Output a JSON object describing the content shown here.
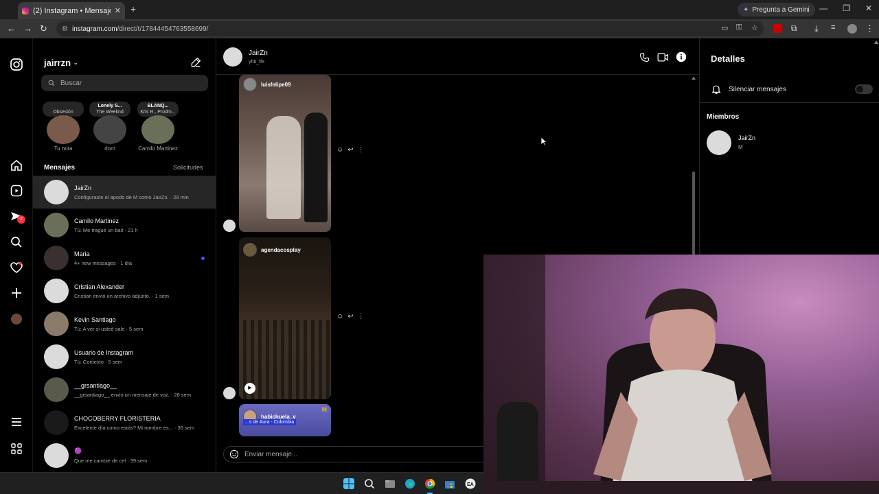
{
  "browser": {
    "tab_title": "(2) Instagram • Mensajes",
    "new_tab": "+",
    "gemini_label": "Pregunta a Gemini",
    "url_host": "instagram.com",
    "url_path": "/direct/t/17844454763558699/"
  },
  "inbox": {
    "username": "jairrzn",
    "search_placeholder": "Buscar",
    "notes": [
      {
        "bubble_title": "",
        "bubble_text": "Obsesión actual...",
        "name": "Tu nota",
        "color": "#7a5a4a"
      },
      {
        "bubble_title": "Lonely S...",
        "bubble_text": "The Weeknd",
        "name": "dom",
        "color": "#444444"
      },
      {
        "bubble_title": "BLANQ...",
        "bubble_text": "Kris R., Prodm...",
        "name": "Camilo Martinez",
        "color": "#6a6f5a"
      }
    ],
    "messages_header": "Mensajes",
    "requests_label": "Solicitudes",
    "conversations": [
      {
        "name": "JairZn",
        "preview": "Configuraste el apodo de M como JairZn. · 29 min",
        "color": "#dbdbdb",
        "unread": false
      },
      {
        "name": "Camilo Martinez",
        "preview": "Tú: Me tragué un bait · 21 h",
        "color": "#6a6f5a",
        "unread": false
      },
      {
        "name": "Maria",
        "preview": "4+ new messages · 1 día",
        "color": "#3a3030",
        "unread": true
      },
      {
        "name": "Cristian Alexander",
        "preview": "Cristian envió un archivo adjunto. · 1 sem",
        "color": "#dbdbdb",
        "unread": false
      },
      {
        "name": "Kevin Santiago",
        "preview": "Tú: A ver si usted sale · 5 sem",
        "color": "#8a7a6a",
        "unread": false
      },
      {
        "name": "Usuario de Instagram",
        "preview": "Tú: Contexto · 5 sem",
        "color": "#dbdbdb",
        "unread": false
      },
      {
        "name": "__grsantiago__",
        "preview": "__grsantiago__ envió un mensaje de voz. · 26 sem",
        "color": "#5a5a4a",
        "unread": false
      },
      {
        "name": "CHOCOBERRY FLORISTERIA",
        "preview": "Excelente día como estás? Mi nombre es... · 36 sem",
        "color": "#1a1a1a",
        "unread": false
      },
      {
        "name": "🟣",
        "preview": "Que me cambie de cel · 39 sem",
        "color": "#dbdbdb",
        "unread": false
      }
    ]
  },
  "chat": {
    "name": "JairZn",
    "username": "yhb_tfe",
    "posts": [
      {
        "author": "luisfelipe09",
        "bg": "#6a5a50"
      },
      {
        "author": "agendacosplay",
        "bg": "#2a2018"
      },
      {
        "author": "habichuela_v",
        "caption": "...s de Aura - Colombia",
        "bg": "#4a4aa0"
      }
    ],
    "composer_placeholder": "Enviar mensaje..."
  },
  "details": {
    "title": "Detalles",
    "mute_label": "Silenciar mensajes",
    "members_label": "Miembros",
    "member_name": "JairZn",
    "member_nick": "M"
  },
  "colors": {
    "accent_unread": "#3e5bf3",
    "notification_badge": "#ff3040"
  },
  "badges": {
    "messages_count": "2"
  }
}
